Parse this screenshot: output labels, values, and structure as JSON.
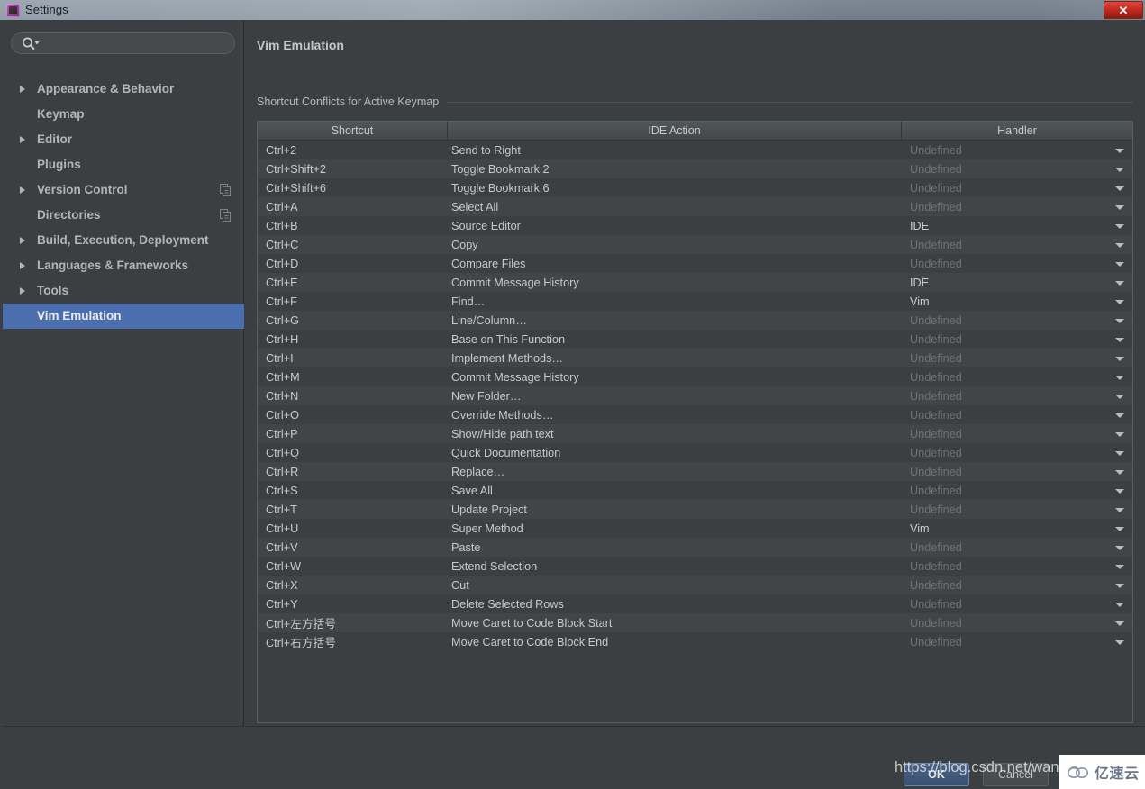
{
  "window": {
    "title": "Settings",
    "app_icon": "settings-app-icon",
    "close_label": "✕"
  },
  "search": {
    "placeholder": "",
    "value": "",
    "icon": "search-icon"
  },
  "sidebar": {
    "items": [
      {
        "label": "Appearance & Behavior",
        "expandable": true,
        "selected": false,
        "badge": false
      },
      {
        "label": "Keymap",
        "expandable": false,
        "selected": false,
        "badge": false
      },
      {
        "label": "Editor",
        "expandable": true,
        "selected": false,
        "badge": false
      },
      {
        "label": "Plugins",
        "expandable": false,
        "selected": false,
        "badge": false
      },
      {
        "label": "Version Control",
        "expandable": true,
        "selected": false,
        "badge": true
      },
      {
        "label": "Directories",
        "expandable": false,
        "selected": false,
        "badge": true
      },
      {
        "label": "Build, Execution, Deployment",
        "expandable": true,
        "selected": false,
        "badge": false
      },
      {
        "label": "Languages & Frameworks",
        "expandable": true,
        "selected": false,
        "badge": false
      },
      {
        "label": "Tools",
        "expandable": true,
        "selected": false,
        "badge": false
      },
      {
        "label": "Vim Emulation",
        "expandable": false,
        "selected": true,
        "badge": false
      }
    ],
    "help_label": "?"
  },
  "content": {
    "page_title": "Vim Emulation",
    "section_label": "Shortcut Conflicts for Active Keymap",
    "table": {
      "columns": [
        "Shortcut",
        "IDE Action",
        "Handler"
      ],
      "rows": [
        {
          "shortcut": "Ctrl+2",
          "action": "Send to Right",
          "handler": "Undefined"
        },
        {
          "shortcut": "Ctrl+Shift+2",
          "action": "Toggle Bookmark 2",
          "handler": "Undefined"
        },
        {
          "shortcut": "Ctrl+Shift+6",
          "action": "Toggle Bookmark 6",
          "handler": "Undefined"
        },
        {
          "shortcut": "Ctrl+A",
          "action": "Select All",
          "handler": "Undefined"
        },
        {
          "shortcut": "Ctrl+B",
          "action": "Source Editor",
          "handler": "IDE"
        },
        {
          "shortcut": "Ctrl+C",
          "action": "Copy",
          "handler": "Undefined"
        },
        {
          "shortcut": "Ctrl+D",
          "action": "Compare Files",
          "handler": "Undefined"
        },
        {
          "shortcut": "Ctrl+E",
          "action": "Commit Message History",
          "handler": "IDE"
        },
        {
          "shortcut": "Ctrl+F",
          "action": "Find…",
          "handler": "Vim"
        },
        {
          "shortcut": "Ctrl+G",
          "action": "Line/Column…",
          "handler": "Undefined"
        },
        {
          "shortcut": "Ctrl+H",
          "action": "Base on This Function",
          "handler": "Undefined"
        },
        {
          "shortcut": "Ctrl+I",
          "action": "Implement Methods…",
          "handler": "Undefined"
        },
        {
          "shortcut": "Ctrl+M",
          "action": "Commit Message History",
          "handler": "Undefined"
        },
        {
          "shortcut": "Ctrl+N",
          "action": "New Folder…",
          "handler": "Undefined"
        },
        {
          "shortcut": "Ctrl+O",
          "action": "Override Methods…",
          "handler": "Undefined"
        },
        {
          "shortcut": "Ctrl+P",
          "action": "Show/Hide path text",
          "handler": "Undefined"
        },
        {
          "shortcut": "Ctrl+Q",
          "action": "Quick Documentation",
          "handler": "Undefined"
        },
        {
          "shortcut": "Ctrl+R",
          "action": "Replace…",
          "handler": "Undefined"
        },
        {
          "shortcut": "Ctrl+S",
          "action": "Save All",
          "handler": "Undefined"
        },
        {
          "shortcut": "Ctrl+T",
          "action": "Update Project",
          "handler": "Undefined"
        },
        {
          "shortcut": "Ctrl+U",
          "action": "Super Method",
          "handler": "Vim"
        },
        {
          "shortcut": "Ctrl+V",
          "action": "Paste",
          "handler": "Undefined"
        },
        {
          "shortcut": "Ctrl+W",
          "action": "Extend Selection",
          "handler": "Undefined"
        },
        {
          "shortcut": "Ctrl+X",
          "action": "Cut",
          "handler": "Undefined"
        },
        {
          "shortcut": "Ctrl+Y",
          "action": "Delete Selected Rows",
          "handler": "Undefined"
        },
        {
          "shortcut": "Ctrl+左方括号",
          "action": "Move Caret to Code Block Start",
          "handler": "Undefined"
        },
        {
          "shortcut": "Ctrl+右方括号",
          "action": "Move Caret to Code Block End",
          "handler": "Undefined"
        }
      ]
    }
  },
  "footer": {
    "ok_label": "OK",
    "cancel_label": "Cancel"
  },
  "watermarks": {
    "csdn": "https://blog.csdn.net/wan",
    "yisuyun": "亿速云"
  },
  "colors": {
    "accent_selection": "#4b6eaf",
    "panel_bg": "#3c3f41",
    "row_alt_bg": "#414547",
    "text": "#c6cacc",
    "text_disabled": "#6e7275",
    "close_red": "#c62a20"
  }
}
